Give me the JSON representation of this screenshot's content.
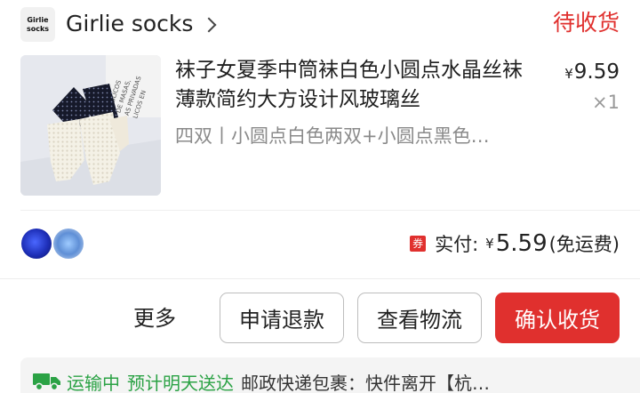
{
  "shop": {
    "logo_line1": "Girlie",
    "logo_line2": "socks",
    "name": "Girlie socks",
    "status": "待收货"
  },
  "product": {
    "title": "袜子女夏季中筒袜白色小圆点水晶丝袜薄款简约大方设计风玻璃丝",
    "spec": "四双丨小圆点白色两双+小圆点黑色…",
    "price_currency": "¥",
    "price_value": "9.59",
    "quantity": "×1",
    "thumb_text": "PUBLICOS\nDE MASAS,\nAS PRIVADAS\nLICOS EN"
  },
  "payment": {
    "coupon_label": "券",
    "label": "实付:",
    "currency": "¥",
    "amount": "5.59",
    "note": "(免运费)"
  },
  "actions": {
    "more": "更多",
    "refund": "申请退款",
    "logistics": "查看物流",
    "confirm": "确认收货"
  },
  "logistics": {
    "status": "运输中",
    "eta": "预计明天送达",
    "detail": "邮政快递包裹：快件离开【杭…"
  },
  "colors": {
    "accent_red": "#e0302e",
    "logistics_green": "#2ba245"
  },
  "icons": {
    "chevron": "chevron-right-icon",
    "truck": "truck-icon"
  }
}
